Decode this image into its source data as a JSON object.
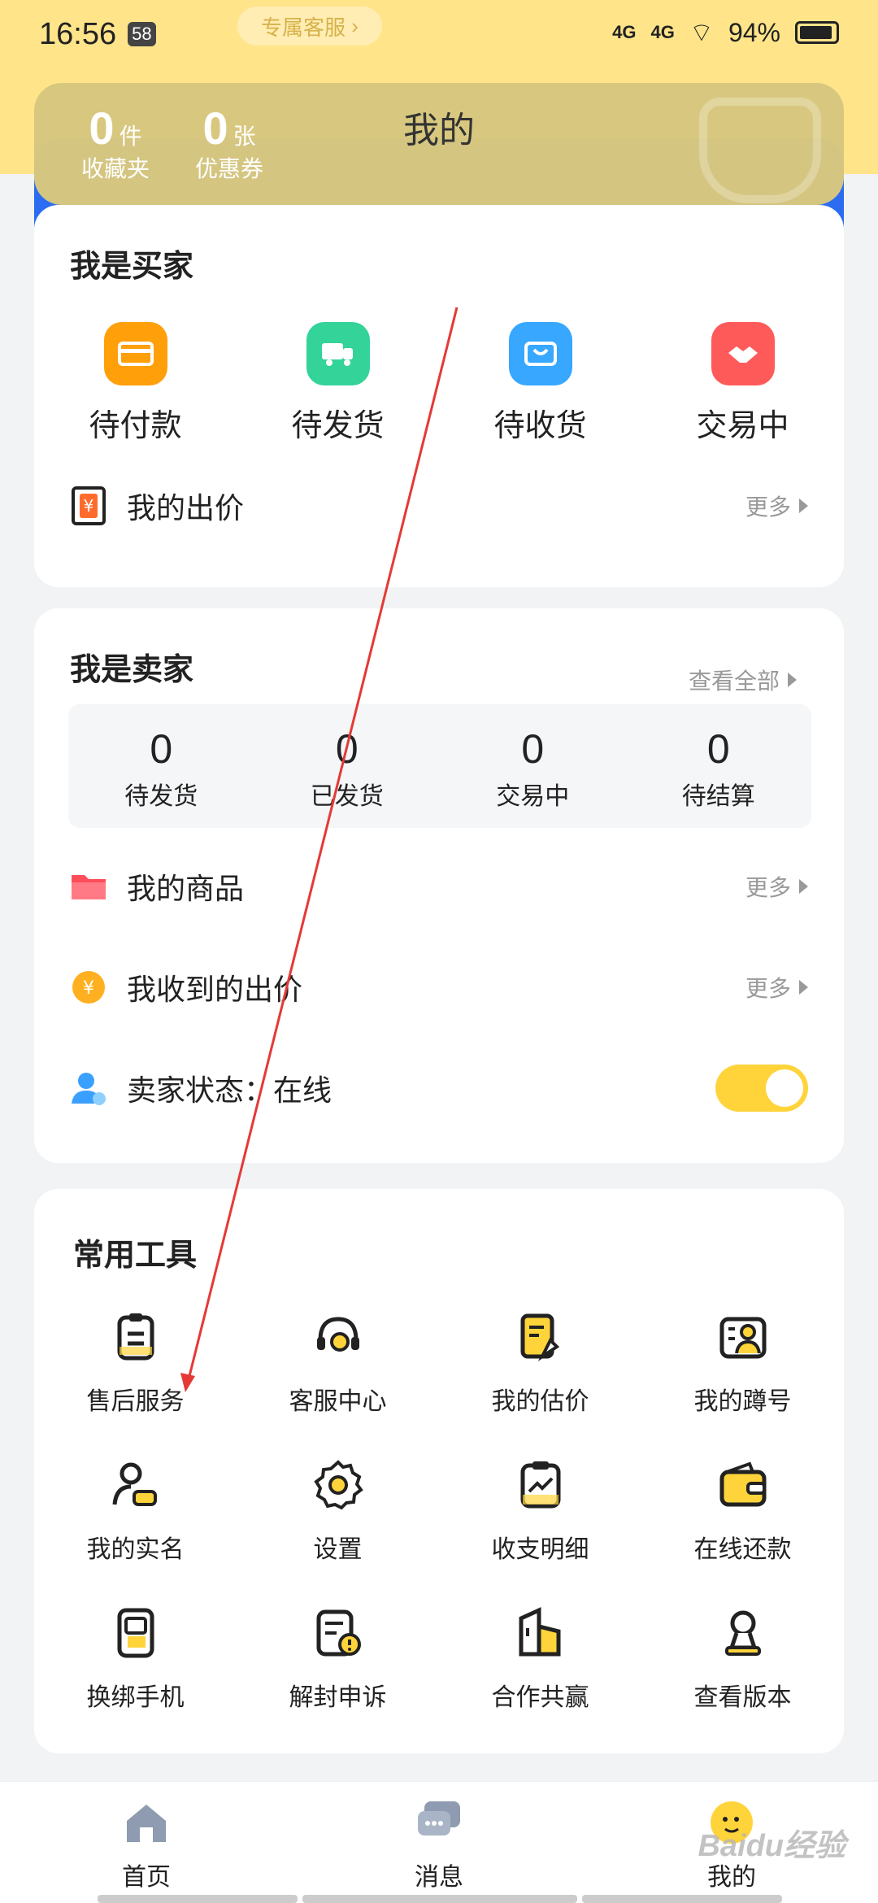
{
  "status": {
    "time": "16:56",
    "badge": "58",
    "signal1": "4G",
    "signal2": "4G",
    "battery": "94%",
    "service_pill": "专属客服"
  },
  "hero": {
    "title": "我的",
    "stats": [
      {
        "num": "0",
        "unit": "件",
        "label": "收藏夹"
      },
      {
        "num": "0",
        "unit": "张",
        "label": "优惠券"
      }
    ]
  },
  "buyer": {
    "title": "我是买家",
    "items": [
      {
        "label": "待付款",
        "icon": "wallet-card-icon",
        "color": "#ff9f0a"
      },
      {
        "label": "待发货",
        "icon": "truck-icon",
        "color": "#34d399"
      },
      {
        "label": "待收货",
        "icon": "shopping-bag-icon",
        "color": "#38a7ff"
      },
      {
        "label": "交易中",
        "icon": "handshake-icon",
        "color": "#ff5a5a"
      }
    ],
    "bid_row": {
      "label": "我的出价",
      "more": "更多"
    }
  },
  "seller": {
    "title": "我是卖家",
    "view_all": "查看全部",
    "stats": [
      {
        "num": "0",
        "label": "待发货"
      },
      {
        "num": "0",
        "label": "已发货"
      },
      {
        "num": "0",
        "label": "交易中"
      },
      {
        "num": "0",
        "label": "待结算"
      }
    ],
    "rows": [
      {
        "label": "我的商品",
        "more": "更多"
      },
      {
        "label": "我收到的出价",
        "more": "更多"
      }
    ],
    "status_row": {
      "label": "卖家状态：在线",
      "toggle_on": true
    }
  },
  "tools": {
    "title": "常用工具",
    "items": [
      [
        {
          "label": "售后服务",
          "icon": "clipboard-icon"
        },
        {
          "label": "客服中心",
          "icon": "headset-icon"
        },
        {
          "label": "我的估价",
          "icon": "appraisal-icon"
        },
        {
          "label": "我的蹲号",
          "icon": "watchlist-icon"
        }
      ],
      [
        {
          "label": "我的实名",
          "icon": "id-person-icon"
        },
        {
          "label": "设置",
          "icon": "gear-icon"
        },
        {
          "label": "收支明细",
          "icon": "statement-icon"
        },
        {
          "label": "在线还款",
          "icon": "wallet-icon"
        }
      ],
      [
        {
          "label": "换绑手机",
          "icon": "phone-icon"
        },
        {
          "label": "解封申诉",
          "icon": "appeal-icon"
        },
        {
          "label": "合作共赢",
          "icon": "building-icon"
        },
        {
          "label": "查看版本",
          "icon": "version-icon"
        }
      ]
    ]
  },
  "nav": [
    {
      "label": "首页",
      "icon": "home-icon"
    },
    {
      "label": "消息",
      "icon": "message-icon"
    },
    {
      "label": "我的",
      "icon": "profile-icon"
    }
  ],
  "watermark": "Baidu经验",
  "colors": {
    "accent_yellow": "#ffd43b",
    "hero_blue": "#2b6cf0",
    "annotation_red": "#e53935"
  }
}
